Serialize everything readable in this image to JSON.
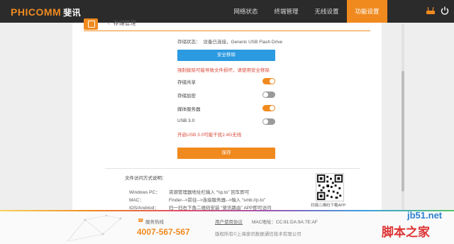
{
  "header": {
    "brand": "PHICOMM",
    "brand_cn": "斐讯",
    "nav": [
      {
        "label": "网络状态",
        "active": false
      },
      {
        "label": "终端管理",
        "active": false
      },
      {
        "label": "无线设置",
        "active": false
      },
      {
        "label": "功能设置",
        "active": true
      }
    ],
    "icons": [
      "router-icon",
      "power-icon"
    ]
  },
  "page": {
    "back_label": "存储管理",
    "status_label": "存储状态：",
    "status_value": "设备已连接，Generic USB Flash Drive",
    "remove_button": "安全移除",
    "remove_warning": "强制拔除可能导致文件损坏，请使用安全移除",
    "options": [
      {
        "label": "存储共享",
        "on": true
      },
      {
        "label": "存储加密",
        "on": false
      },
      {
        "label": "媒体服务器",
        "on": true
      },
      {
        "label": "USB 3.0",
        "on": false
      }
    ],
    "usb_warning": "开启USB 3.0可能干扰2.4G无线",
    "save_button": "保存"
  },
  "help": {
    "title": "文件访问方式说明：",
    "rows": [
      {
        "os": "Windows PC：",
        "text": "资源管理器地址栏输入 “\\\\p.to” 回车即可"
      },
      {
        "os": "MAC：",
        "text": "Finder-->前往-->连接服务器-->输入 “smb://p.to”"
      },
      {
        "os": "IOS/Andriod：",
        "text": "扫一扫右下角二维码安装 “斐讯路由” APP即可访问"
      }
    ],
    "qr_caption": "扫描二维码下载APP"
  },
  "footer": {
    "phone_label": "服务热线",
    "phone": "4007-567-567",
    "agreement": "用户使用协议",
    "mac": "MAC地址：CC:81:DA:9A:7E:AF",
    "copyright": "版权所有©上海斐讯数据通信技术有限公司"
  },
  "watermark": {
    "site": "jb51.net",
    "cn": "脚本之家"
  },
  "colors": {
    "accent": "#f08a1f",
    "topbar": "#2b2b2b",
    "blue_button": "#2b9ae0",
    "warning": "#d94a3a"
  }
}
